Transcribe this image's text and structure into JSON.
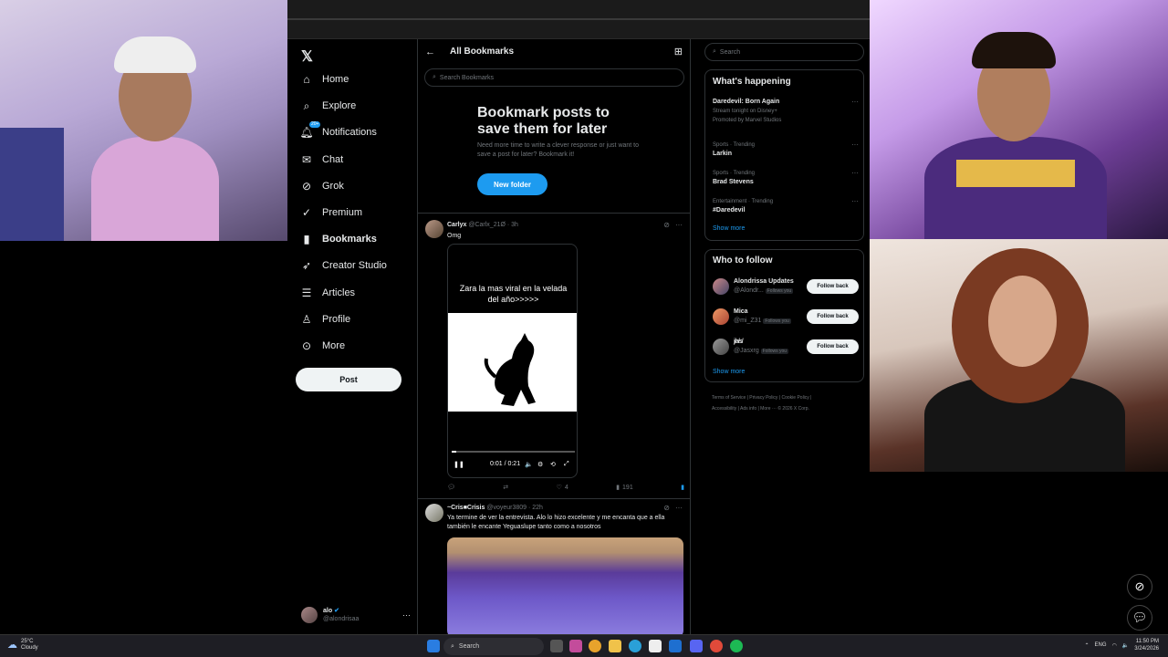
{
  "sidebar": {
    "logo": "𝕏",
    "items": [
      {
        "label": "Home",
        "icon": "home-icon"
      },
      {
        "label": "Explore",
        "icon": "search-icon"
      },
      {
        "label": "Notifications",
        "icon": "bell-icon",
        "badge": "20+"
      },
      {
        "label": "Chat",
        "icon": "mail-icon"
      },
      {
        "label": "Grok",
        "icon": "grok-icon"
      },
      {
        "label": "Premium",
        "icon": "premium-icon"
      },
      {
        "label": "Bookmarks",
        "icon": "bookmark-icon"
      },
      {
        "label": "Creator Studio",
        "icon": "rocket-icon"
      },
      {
        "label": "Articles",
        "icon": "article-icon"
      },
      {
        "label": "Profile",
        "icon": "person-icon"
      },
      {
        "label": "More",
        "icon": "more-circle-icon"
      }
    ],
    "post_button": "Post",
    "account": {
      "name": "alo",
      "handle": "@alondrisaa"
    }
  },
  "main": {
    "title": "All Bookmarks",
    "search_placeholder": "Search Bookmarks",
    "empty_title": "Bookmark posts to save them for later",
    "empty_sub": "Need more time to write a clever response or just want to save a post for later? Bookmark it!",
    "new_folder": "New folder",
    "posts": [
      {
        "name": "Carlyx",
        "handle": "@Carlx_21Ø",
        "time": "· 3h",
        "text": "Omg",
        "video_caption": "Zara la mas viral en la velada del año>>>>>",
        "video_time": "0:01 / 0:21",
        "video_progress": 0.04,
        "likes": "4",
        "views": "191"
      },
      {
        "name": "~Cris■Crisis",
        "handle": "@voyeur3809",
        "time": "· 22h",
        "text": "Ya termine de ver la entrevista. Alo lo hizo excelente y me encanta que a ella también le encante Yeguaslupe tanto como a nosotros"
      }
    ]
  },
  "right": {
    "search_placeholder": "Search",
    "whats_happening": "What's happening",
    "trends": [
      {
        "cat": "",
        "name": "Daredevil: Born Again",
        "sub": "Stream tonight on Disney+",
        "promo": "Promoted by Marvel Studios"
      },
      {
        "cat": "Sports · Trending",
        "name": "Larkin",
        "sub": "",
        "promo": ""
      },
      {
        "cat": "Sports · Trending",
        "name": "Brad Stevens",
        "sub": "",
        "promo": ""
      },
      {
        "cat": "Entertainment · Trending",
        "name": "#Daredevil",
        "sub": "",
        "promo": ""
      }
    ],
    "show_more": "Show more",
    "who_to_follow": "Who to follow",
    "follows": [
      {
        "name": "Alondrissa Updates",
        "handle": "@Alondr...",
        "tag": "Follows you",
        "btn": "Follow back"
      },
      {
        "name": "Mica",
        "handle": "@mi_Z31",
        "tag": "Follows you",
        "btn": "Follow back"
      },
      {
        "name": "j̸a̸s̸",
        "handle": "@Jasxrg",
        "tag": "Follows you",
        "btn": "Follow back"
      }
    ],
    "show_more2": "Show more",
    "footer1": "Terms of Service  |  Privacy Policy  |  Cookie Policy  |",
    "footer2": "Accessibility  |  Ads info  |  More ···  © 2026 X Corp."
  },
  "taskbar": {
    "temp": "25°C",
    "weather": "Cloudy",
    "search": "Search",
    "lang": "ENG",
    "time": "11:50 PM",
    "date": "3/24/2026"
  }
}
